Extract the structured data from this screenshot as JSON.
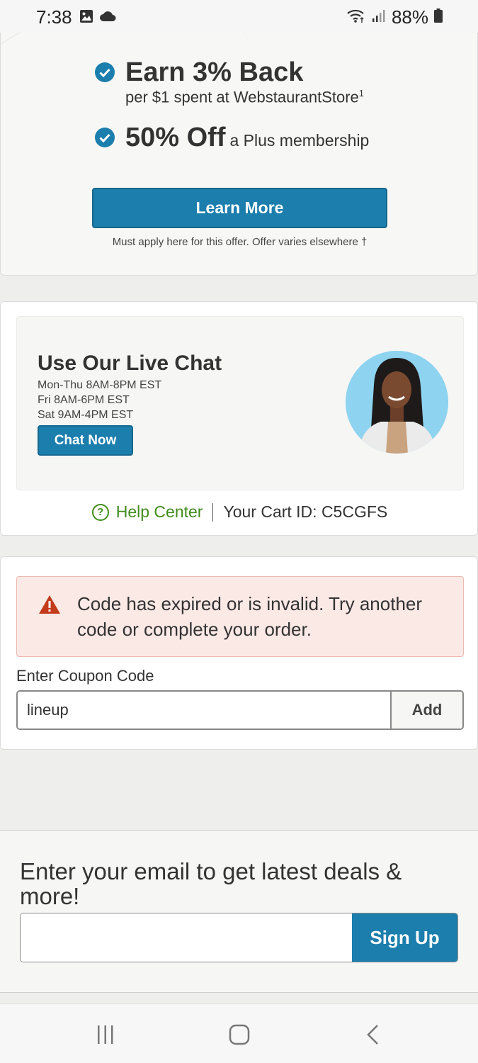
{
  "status_bar": {
    "time": "7:38",
    "battery": "88%"
  },
  "offer": {
    "line1_big": "Earn 3% Back",
    "line1_sub": "per $1 spent at WebstaurantStore",
    "line1_sup": "1",
    "line2_big": "50% Off",
    "line2_sub": "a Plus membership",
    "button": "Learn More",
    "note": "Must apply here for this offer. Offer varies elsewhere †",
    "accent": "#1b7ead"
  },
  "chat": {
    "title": "Use Our Live Chat",
    "hours": [
      "Mon-Thu 8AM-8PM EST",
      "Fri 8AM-6PM EST",
      "Sat 9AM-4PM EST"
    ],
    "button": "Chat Now",
    "help_label": "Help Center",
    "cart_id": "Your Cart ID: C5CGFS"
  },
  "coupon": {
    "alert": "Code has expired or is invalid. Try another code or complete your order.",
    "label": "Enter Coupon Code",
    "value": "lineup",
    "button": "Add"
  },
  "email": {
    "heading": "Enter your email to get latest deals & more!",
    "placeholder": "",
    "button": "Sign Up"
  }
}
